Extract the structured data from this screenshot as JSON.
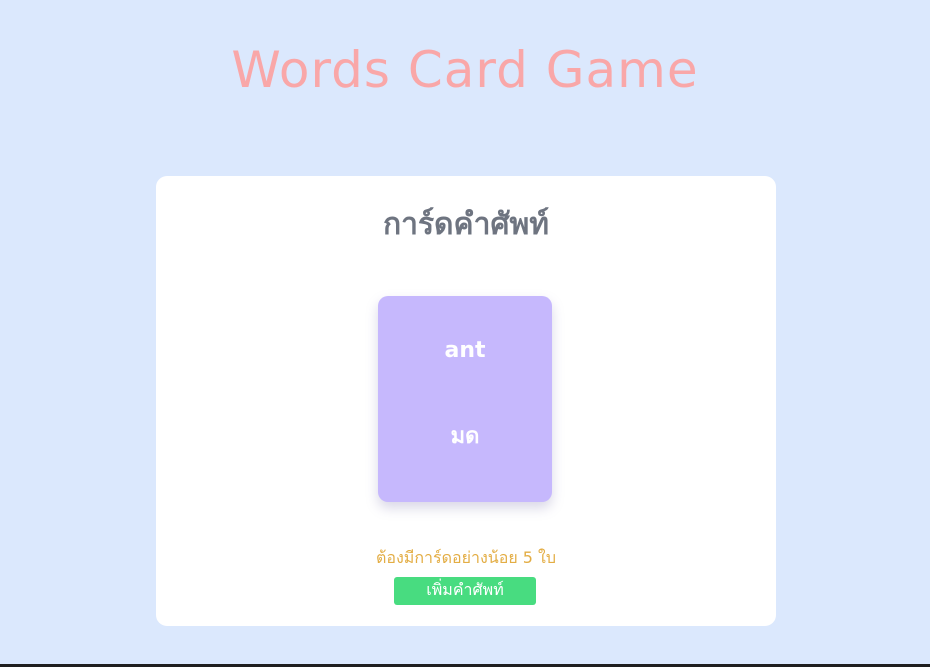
{
  "app": {
    "title": "Words Card Game"
  },
  "panel": {
    "title": "การ์ดคำศัพท์"
  },
  "card": {
    "word": "ant",
    "meaning": "มด"
  },
  "footer": {
    "warning": "ต้องมีการ์ดอย่างน้อย 5 ใบ",
    "add_button_label": "เพิ่มคำศัพท์"
  },
  "colors": {
    "background": "#dbe8fd",
    "title": "#f9a7a8",
    "card": "#c6b8fd",
    "warning": "#e3ad44",
    "button": "#48dc80"
  }
}
